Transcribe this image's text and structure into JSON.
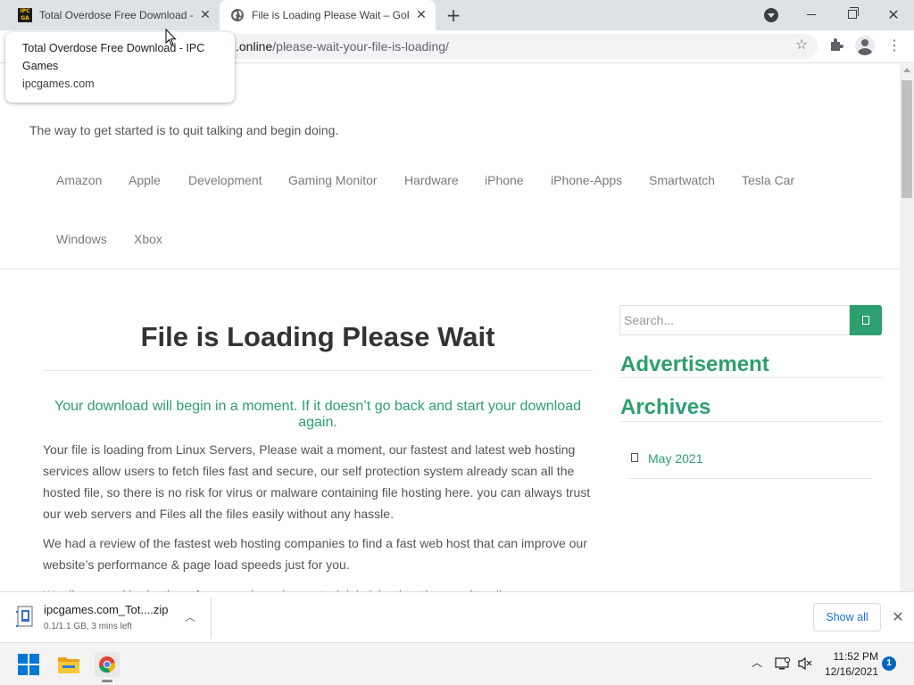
{
  "browser": {
    "tabs": [
      {
        "title": "Total Overdose Free Download - IPC Games",
        "favicon": "ipc-games-favicon",
        "active": false
      },
      {
        "title": "File is Loading Please Wait – GoRunTo",
        "favicon": "globe-icon",
        "active": true
      }
    ],
    "hover_card": {
      "title": "Total Overdose Free Download - IPC Games",
      "domain": "ipcgames.com"
    },
    "address_bar": {
      "host_visible": ".online",
      "path": "/please-wait-your-file-is-loading/"
    },
    "toolbar_icons": [
      "bookmark-star-icon",
      "extensions-puzzle-icon",
      "profile-avatar-icon",
      "menu-kebab-icon"
    ],
    "window_controls": [
      "minimize",
      "maximize",
      "close"
    ]
  },
  "site": {
    "tagline": "The way to get started is to quit talking and begin doing.",
    "nav": [
      "Amazon",
      "Apple",
      "Development",
      "Gaming Monitor",
      "Hardware",
      "iPhone",
      "iPhone-Apps",
      "Smartwatch",
      "Tesla Car",
      "Windows",
      "Xbox"
    ]
  },
  "article": {
    "title": "File is Loading Please Wait",
    "lead": "Your download will begin in a moment. If it doesn’t go back and start your download again.",
    "paragraphs": [
      "Your file is loading from Linux Servers, Please wait a moment, our fastest and latest web hosting services allow users to fetch files fast and secure, our self protection system already scan all the hosted file, so there is no risk for virus or malware containing file hosting here. you can always trust our web servers and Files all the files easily without any hassle.",
      "We had a review of the fastest web hosting companies to find a fast web host that can improve our website’s performance & page load speeds just for you.",
      "We discovered in-depth performance based on actual, lab & load testing results, all..."
    ]
  },
  "sidebar": {
    "search_placeholder": "Search...",
    "widgets": [
      {
        "title": "Advertisement"
      },
      {
        "title": "Archives",
        "items": [
          "May 2021"
        ]
      }
    ]
  },
  "download_shelf": {
    "file_name": "ipcgames.com_Tot....zip",
    "status": "0.1/1.1 GB, 3 mins left",
    "show_all_label": "Show all"
  },
  "taskbar": {
    "pinned": [
      "windows-start-icon",
      "file-explorer-icon",
      "chrome-icon"
    ],
    "time": "11:52 PM",
    "date": "12/16/2021",
    "notification_count": "1"
  },
  "colors": {
    "accent_green": "#2d9f6f",
    "chrome_link_blue": "#1a73e8",
    "tabstrip_bg": "#dee1e6"
  }
}
